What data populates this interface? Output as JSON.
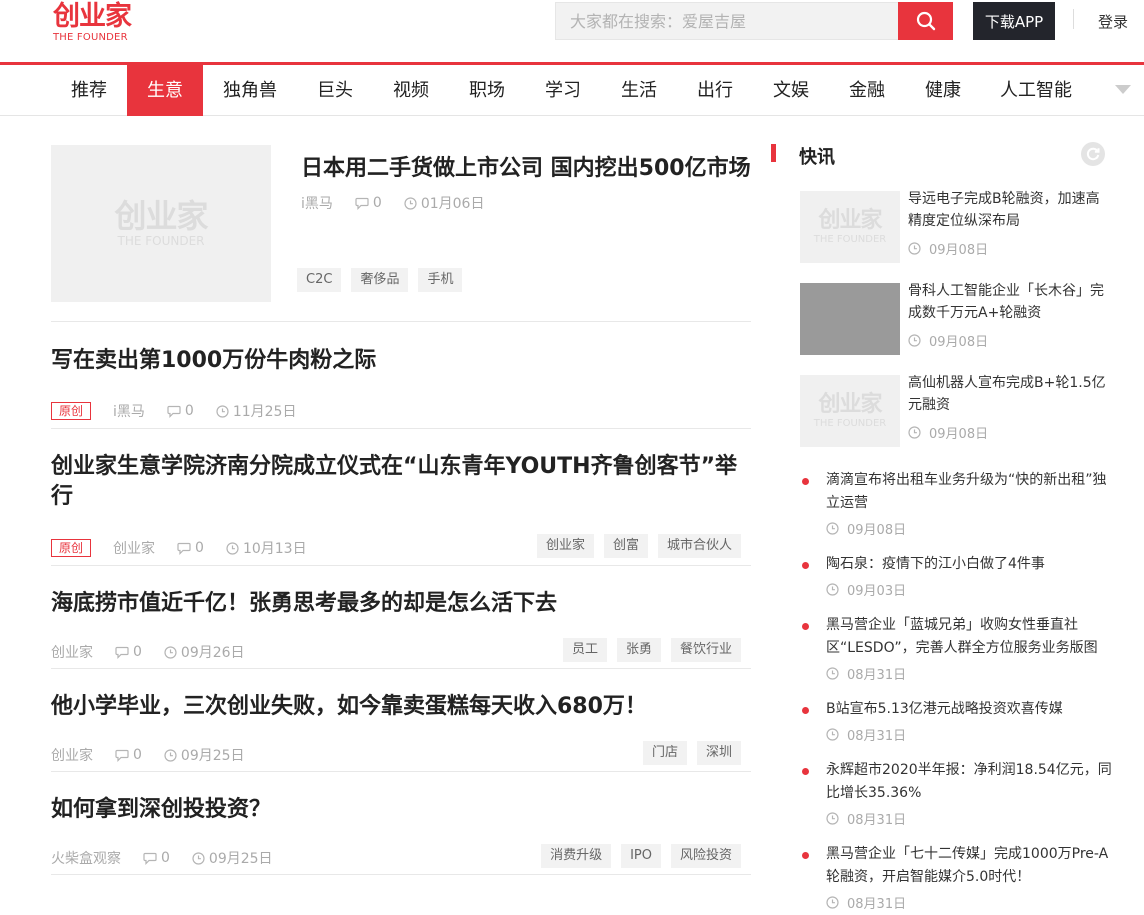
{
  "header": {
    "logo_cn": "创业家",
    "logo_en": "THE FOUNDER",
    "search_placeholder": "大家都在搜索：爱屋吉屋",
    "download_label": "下载APP",
    "login_label": "登录"
  },
  "nav": [
    "推荐",
    "生意",
    "独角兽",
    "巨头",
    "视频",
    "职场",
    "学习",
    "生活",
    "出行",
    "文娱",
    "金融",
    "健康",
    "人工智能"
  ],
  "nav_active": "生意",
  "feature": {
    "title": "日本用二手货做上市公司 国内挖出500亿市场",
    "author": "i黑马",
    "comments": "0",
    "date": "01月06日",
    "tags": [
      "C2C",
      "奢侈品",
      "手机"
    ],
    "thumb_cn": "创业家",
    "thumb_en": "THE FOUNDER"
  },
  "articles": [
    {
      "title": "写在卖出第1000万份牛肉粉之际",
      "badge": "原创",
      "author": "i黑马",
      "comments": "0",
      "date": "11月25日",
      "tags": []
    },
    {
      "title": "创业家生意学院济南分院成立仪式在“山东青年YOUTH齐鲁创客节”举行",
      "badge": "原创",
      "author": "创业家",
      "comments": "0",
      "date": "10月13日",
      "tags": [
        "创业家",
        "创富",
        "城市合伙人"
      ]
    },
    {
      "title": "海底捞市值近千亿！张勇思考最多的却是怎么活下去",
      "badge": "",
      "author": "创业家",
      "comments": "0",
      "date": "09月26日",
      "tags": [
        "员工",
        "张勇",
        "餐饮行业"
      ]
    },
    {
      "title": "他小学毕业，三次创业失败，如今靠卖蛋糕每天收入680万！",
      "badge": "",
      "author": "创业家",
      "comments": "0",
      "date": "09月25日",
      "tags": [
        "门店",
        "深圳"
      ]
    },
    {
      "title": "如何拿到深创投投资？",
      "badge": "",
      "author": "火柴盒观察",
      "comments": "0",
      "date": "09月25日",
      "tags": [
        "消费升级",
        "IPO",
        "风险投资"
      ]
    }
  ],
  "sidebar": {
    "title": "快讯",
    "image_news": [
      {
        "text": "导远电子完成B轮融资，加速高精度定位纵深布局",
        "date": "09月08日",
        "thumb": "logo"
      },
      {
        "text": "骨科人工智能企业「长木谷」完成数千万元A+轮融资",
        "date": "09月08日",
        "thumb": "gray"
      },
      {
        "text": "高仙机器人宣布完成B+轮1.5亿元融资",
        "date": "09月08日",
        "thumb": "logo"
      }
    ],
    "dot_news": [
      {
        "text": "滴滴宣布将出租车业务升级为“快的新出租”独立运营",
        "date": "09月08日"
      },
      {
        "text": "陶石泉：疫情下的江小白做了4件事",
        "date": "09月03日"
      },
      {
        "text": "黑马营企业「蓝城兄弟」收购女性垂直社区“LESDO”，完善人群全方位服务业务版图",
        "date": "08月31日"
      },
      {
        "text": "B站宣布5.13亿港元战略投资欢喜传媒",
        "date": "08月31日"
      },
      {
        "text": "永辉超市2020半年报：净利润18.54亿元，同比增长35.36%",
        "date": "08月31日"
      },
      {
        "text": "黑马营企业「七十二传媒」完成1000万Pre-A轮融资，开启智能媒介5.0时代！",
        "date": "08月31日"
      }
    ]
  },
  "colors": {
    "accent": "#e8343d",
    "dark_button": "#23252c"
  }
}
